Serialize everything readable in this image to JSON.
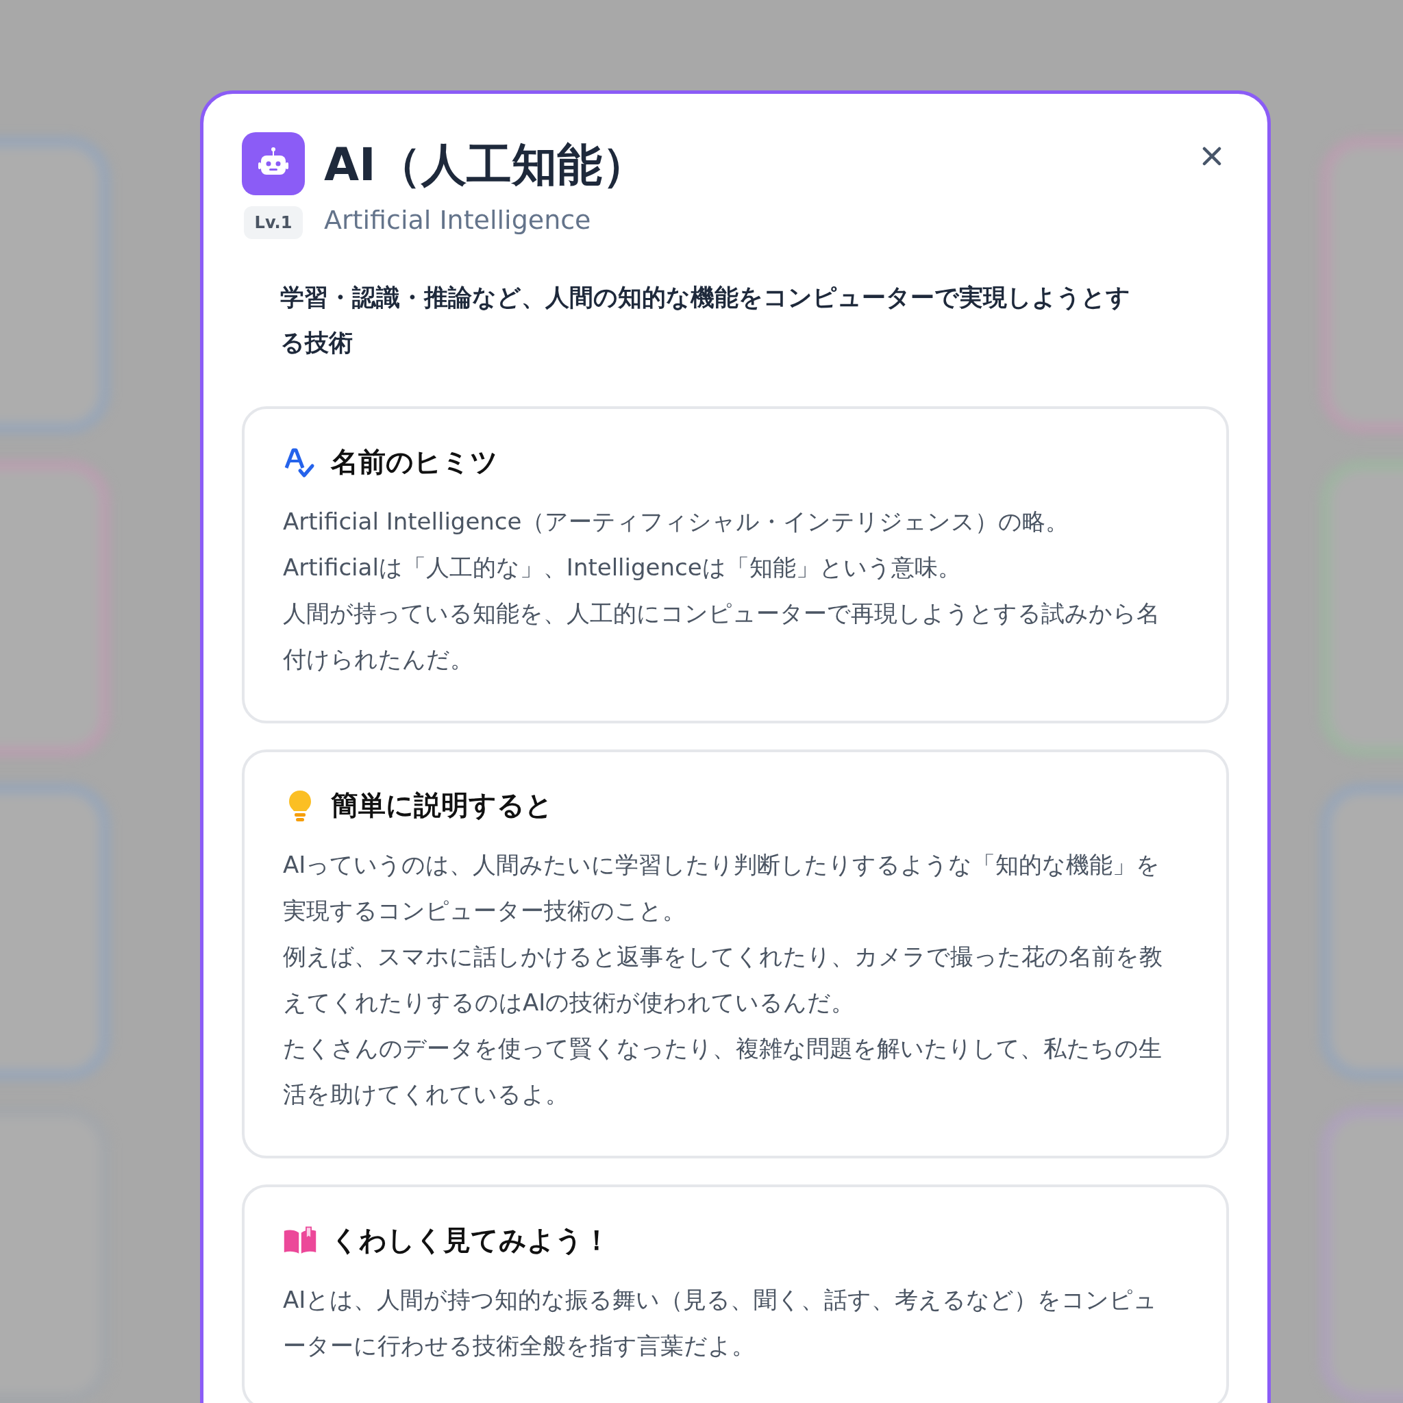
{
  "modal": {
    "title": "AI（人工知能）",
    "level_badge": "Lv.1",
    "subtitle": "Artificial Intelligence",
    "description": "学習・認識・推論など、人間の知的な機能をコンピューターで実現しようとする技術",
    "sections": [
      {
        "kind": "name",
        "heading": "名前のヒミツ",
        "paragraphs": [
          "Artificial Intelligence（アーティフィシャル・インテリジェンス）の略。",
          "Artificialは「人工的な」、Intelligenceは「知能」という意味。",
          "人間が持っている知能を、人工的にコンピューターで再現しようとする試みから名付けられたんだ。"
        ]
      },
      {
        "kind": "simple",
        "heading": "簡単に説明すると",
        "paragraphs": [
          "AIっていうのは、人間みたいに学習したり判断したりするような「知的な機能」を実現するコンピューター技術のこと。",
          "例えば、スマホに話しかけると返事をしてくれたり、カメラで撮った花の名前を教えてくれたりするのはAIの技術が使われているんだ。",
          "たくさんのデータを使って賢くなったり、複雑な問題を解いたりして、私たちの生活を助けてくれているよ。"
        ]
      },
      {
        "kind": "detail",
        "heading": "くわしく見てみよう！",
        "paragraphs": [
          "AIとは、人間が持つ知的な振る舞い（見る、聞く、話す、考えるなど）をコンピューターに行わせる技術全般を指す言葉だよ。"
        ]
      }
    ]
  }
}
